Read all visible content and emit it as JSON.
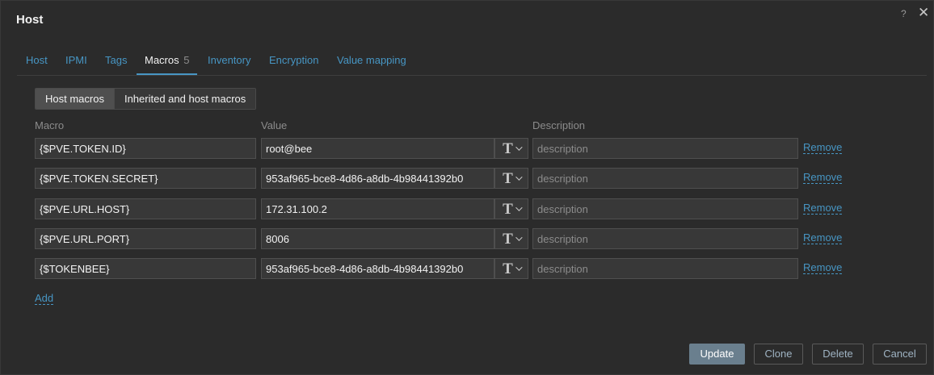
{
  "dialog": {
    "title": "Host",
    "help_icon": "?",
    "close_icon": "✕"
  },
  "tabs": [
    {
      "label": "Host",
      "active": false
    },
    {
      "label": "IPMI",
      "active": false
    },
    {
      "label": "Tags",
      "active": false
    },
    {
      "label": "Macros",
      "count": "5",
      "active": true
    },
    {
      "label": "Inventory",
      "active": false
    },
    {
      "label": "Encryption",
      "active": false
    },
    {
      "label": "Value mapping",
      "active": false
    }
  ],
  "macro_view": {
    "host_macros_label": "Host macros",
    "inherited_label": "Inherited and host macros",
    "selected": "Host macros"
  },
  "columns": {
    "macro": "Macro",
    "value": "Value",
    "description": "Description"
  },
  "macros": [
    {
      "macro": "{$PVE.TOKEN.ID}",
      "value": "root@bee",
      "type": "T",
      "description": "",
      "description_placeholder": "description",
      "remove_label": "Remove"
    },
    {
      "macro": "{$PVE.TOKEN.SECRET}",
      "value": "953af965-bce8-4d86-a8db-4b98441392b0",
      "type": "T",
      "description": "",
      "description_placeholder": "description",
      "remove_label": "Remove"
    },
    {
      "macro": "{$PVE.URL.HOST}",
      "value": "172.31.100.2",
      "type": "T",
      "description": "",
      "description_placeholder": "description",
      "remove_label": "Remove"
    },
    {
      "macro": "{$PVE.URL.PORT}",
      "value": "8006",
      "type": "T",
      "description": "",
      "description_placeholder": "description",
      "remove_label": "Remove"
    },
    {
      "macro": "{$TOKENBEE}",
      "value": "953af965-bce8-4d86-a8db-4b98441392b0",
      "type": "T",
      "description": "",
      "description_placeholder": "description",
      "remove_label": "Remove"
    }
  ],
  "add_label": "Add",
  "footer": {
    "update_label": "Update",
    "clone_label": "Clone",
    "delete_label": "Delete",
    "cancel_label": "Cancel"
  },
  "colors": {
    "background": "#2b2b2b",
    "link": "#4796c4",
    "input_bg": "#383838",
    "primary_button": "#6a7f8e"
  }
}
